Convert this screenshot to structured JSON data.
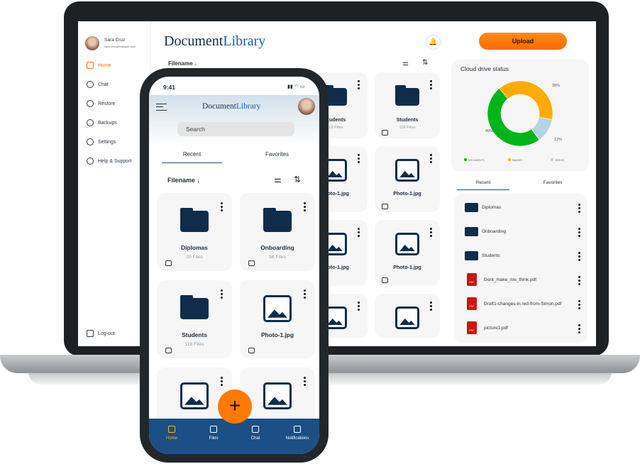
{
  "laptop": {
    "user": {
      "name": "Sara Cruz",
      "email": "sara.cruz@example.com"
    },
    "nav": [
      {
        "label": "Home",
        "icon": "home-icon",
        "active": true
      },
      {
        "label": "Chat",
        "icon": "chat-icon"
      },
      {
        "label": "Restore",
        "icon": "restore-icon"
      },
      {
        "label": "Backups",
        "icon": "cloud-upload-icon"
      },
      {
        "label": "Settings",
        "icon": "gear-icon"
      },
      {
        "label": "Help & Support",
        "icon": "info-icon"
      }
    ],
    "logout": "Log-out",
    "logo": {
      "a": "Document",
      "b": "Library"
    },
    "sort_label": "Filename ↓",
    "upload": "Upload",
    "grid": [
      {
        "type": "folder",
        "title": "Students",
        "sub": "118 Files"
      },
      {
        "type": "folder",
        "title": "Students",
        "sub": "118 Files"
      },
      {
        "type": "image",
        "title": "Photo-1.jpg"
      },
      {
        "type": "image",
        "title": "Photo-1.jpg"
      },
      {
        "type": "image",
        "title": "Photo-1.jpg"
      },
      {
        "type": "image",
        "title": "Photo-1.jpg"
      },
      {
        "type": "image",
        "title": ""
      },
      {
        "type": "image",
        "title": ""
      }
    ],
    "status": {
      "title": "Cloud drive status",
      "slices": [
        {
          "name": "IMAGES",
          "value": 39,
          "label": "39%",
          "color": "#ffab00"
        },
        {
          "name": "VIDEOS",
          "value": 12,
          "label": "12%",
          "color": "#b3d4e0"
        },
        {
          "name": "DOCUMENTS",
          "value": 49,
          "label": "49%",
          "color": "#00b51a"
        }
      ]
    },
    "tabs": [
      "Recent",
      "Favorites"
    ],
    "files": [
      {
        "type": "folder",
        "name": "Diplomas"
      },
      {
        "type": "folder",
        "name": "Onboarding"
      },
      {
        "type": "folder",
        "name": "Students"
      },
      {
        "type": "pdf",
        "name": "Dont_make_me_think.pdf"
      },
      {
        "type": "pdf",
        "name": "Draft1-changes-in.red-from-Simon.pdf"
      },
      {
        "type": "pdf",
        "name": "picture1.pdf"
      }
    ],
    "pdf_badge": "PDF"
  },
  "phone": {
    "time": "9:41",
    "logo": {
      "a": "Document",
      "b": "Library"
    },
    "search_placeholder": "Search",
    "tabs": [
      "Recent",
      "Favorites"
    ],
    "sort_label": "Filename ↓",
    "cards": [
      {
        "type": "folder",
        "title": "Diplomas",
        "sub": "20 Files"
      },
      {
        "type": "folder",
        "title": "Onboarding",
        "sub": "56 Files"
      },
      {
        "type": "folder",
        "title": "Students",
        "sub": "118 Files"
      },
      {
        "type": "image",
        "title": "Photo-1.jpg"
      },
      {
        "type": "image",
        "title": ""
      },
      {
        "type": "image",
        "title": ""
      }
    ],
    "fab": "+",
    "bottom_nav": [
      {
        "label": "Home",
        "icon": "home-icon",
        "active": true
      },
      {
        "label": "Files",
        "icon": "folder-icon"
      },
      {
        "label": "Chat",
        "icon": "chat-icon"
      },
      {
        "label": "Notifications",
        "icon": "bell-icon"
      }
    ],
    "accent": "#ff7a00",
    "nav_color": "#1b4f85"
  }
}
